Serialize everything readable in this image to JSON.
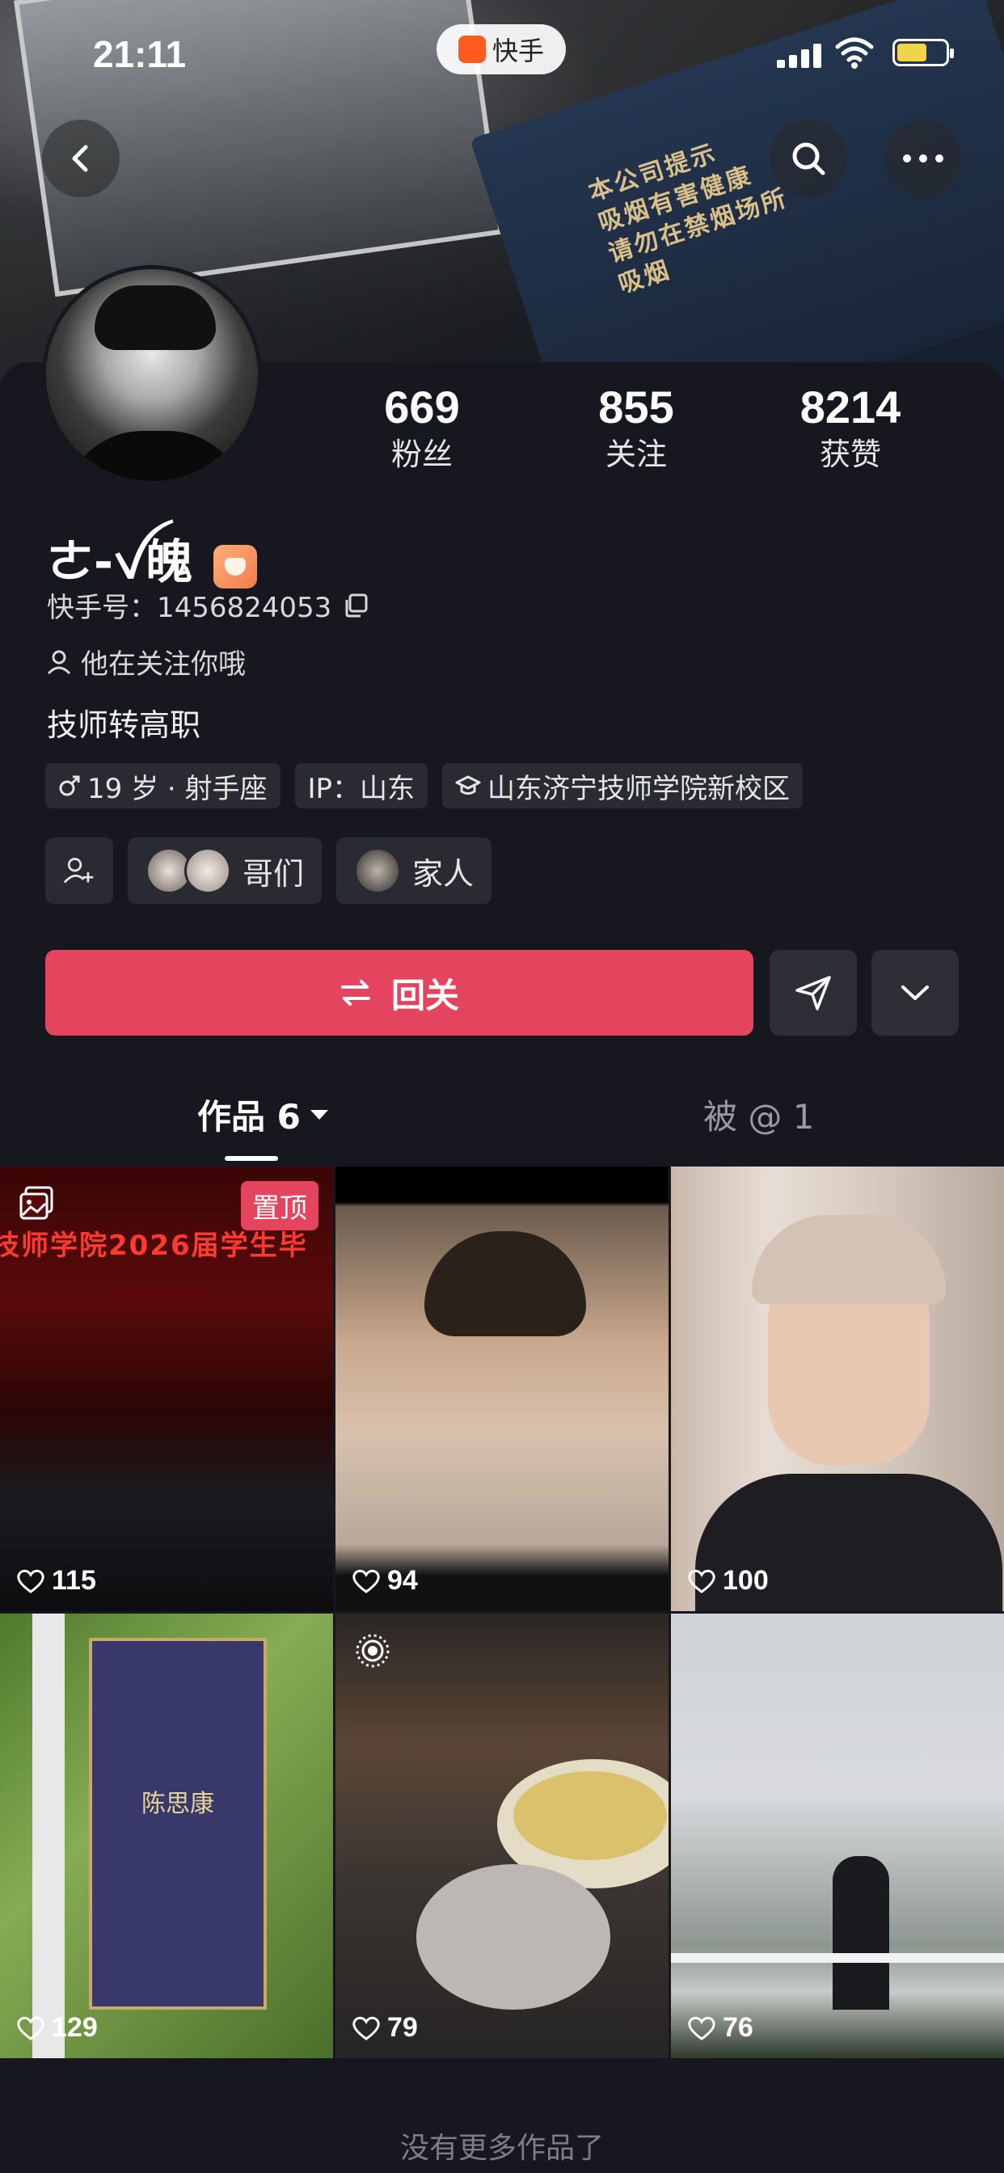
{
  "status_bar": {
    "time": "21:11",
    "app_name": "快手"
  },
  "cover": {
    "warning_lines": [
      "本公司提示",
      "吸烟有害健康",
      "请勿在禁烟场所吸烟"
    ]
  },
  "stats": [
    {
      "value": "669",
      "label": "粉丝"
    },
    {
      "value": "855",
      "label": "关注"
    },
    {
      "value": "8214",
      "label": "获赞"
    }
  ],
  "profile": {
    "name": "ㄜ-ꪜ魄",
    "kuaishou_id": "快手号：1456824053",
    "follow_status": "他在关注你哦",
    "bio": "技师转高职",
    "tags": [
      "19 岁 · 射手座",
      "IP：山东",
      "山东济宁技师学院新校区"
    ],
    "groups": [
      {
        "label": "哥们"
      },
      {
        "label": "家人"
      }
    ]
  },
  "actions": {
    "follow_back": "回关"
  },
  "tabs": {
    "works": "作品 6",
    "mentioned": "被 @ 1"
  },
  "works": [
    {
      "likes": "115",
      "pinned": "置顶",
      "banner": "技师学院2026届学生毕"
    },
    {
      "likes": "94"
    },
    {
      "likes": "100"
    },
    {
      "likes": "129",
      "poster_name": "陈思康"
    },
    {
      "likes": "79"
    },
    {
      "likes": "76"
    }
  ],
  "footer": "没有更多作品了",
  "colors": {
    "accent": "#e5445f",
    "background": "#17171f",
    "chip": "#2a2a32"
  }
}
